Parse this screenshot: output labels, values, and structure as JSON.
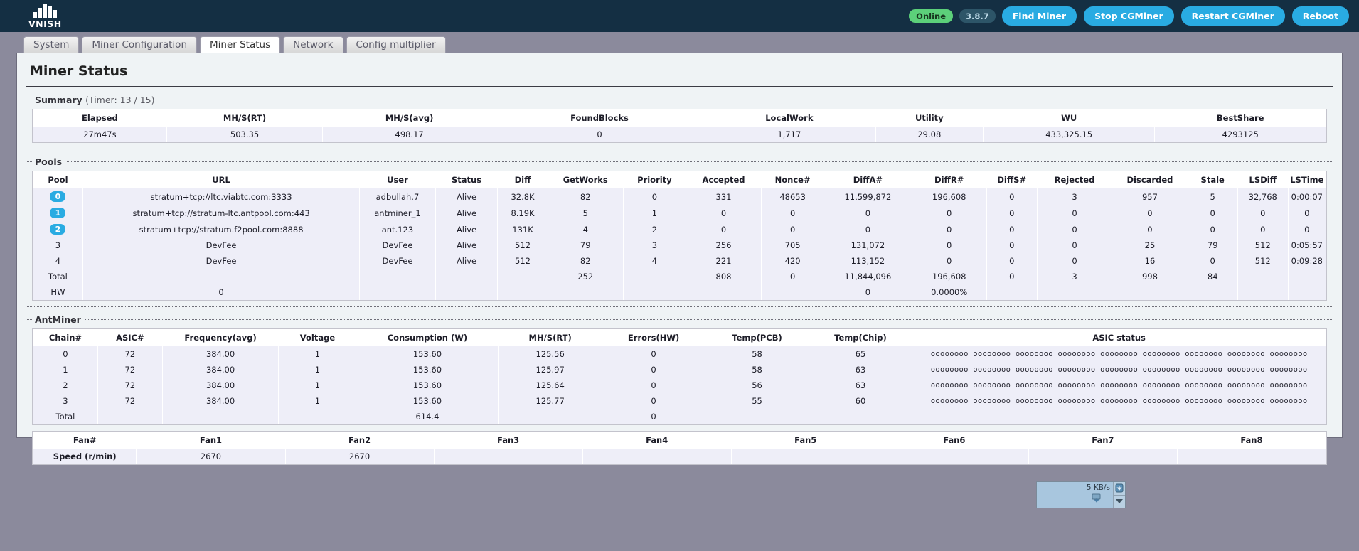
{
  "header": {
    "logo_text": "VNISH",
    "status_badge": "Online",
    "version_badge": "3.8.7",
    "buttons": [
      {
        "name": "find-miner",
        "label": "Find Miner"
      },
      {
        "name": "stop-cgminer",
        "label": "Stop CGMiner"
      },
      {
        "name": "restart-cgminer",
        "label": "Restart CGMiner"
      },
      {
        "name": "reboot",
        "label": "Reboot"
      }
    ],
    "accent_color": "#29abe2",
    "online_color": "#5cd07a",
    "bar_color": "#142f43"
  },
  "tabs": [
    {
      "label": "System",
      "active": false
    },
    {
      "label": "Miner Configuration",
      "active": false
    },
    {
      "label": "Miner Status",
      "active": true
    },
    {
      "label": "Network",
      "active": false
    },
    {
      "label": "Config multiplier",
      "active": false
    }
  ],
  "page": {
    "title": "Miner Status"
  },
  "summary": {
    "legend": "Summary",
    "timer": "(Timer: 13 / 15)",
    "columns": [
      "Elapsed",
      "MH/S(RT)",
      "MH/S(avg)",
      "FoundBlocks",
      "LocalWork",
      "Utility",
      "WU",
      "BestShare"
    ],
    "row": [
      "27m47s",
      "503.35",
      "498.17",
      "0",
      "1,717",
      "29.08",
      "433,325.15",
      "4293125"
    ]
  },
  "pools": {
    "legend": "Pools",
    "columns": [
      "Pool",
      "URL",
      "User",
      "Status",
      "Diff",
      "GetWorks",
      "Priority",
      "Accepted",
      "Nonce#",
      "DiffA#",
      "DiffR#",
      "DiffS#",
      "Rejected",
      "Discarded",
      "Stale",
      "LSDiff",
      "LSTime"
    ],
    "rows": [
      {
        "badge": true,
        "cells": [
          "0",
          "stratum+tcp://ltc.viabtc.com:3333",
          "adbullah.7",
          "Alive",
          "32.8K",
          "82",
          "0",
          "331",
          "48653",
          "11,599,872",
          "196,608",
          "0",
          "3",
          "957",
          "5",
          "32,768",
          "0:00:07"
        ]
      },
      {
        "badge": true,
        "cells": [
          "1",
          "stratum+tcp://stratum-ltc.antpool.com:443",
          "antminer_1",
          "Alive",
          "8.19K",
          "5",
          "1",
          "0",
          "0",
          "0",
          "0",
          "0",
          "0",
          "0",
          "0",
          "0",
          "0"
        ]
      },
      {
        "badge": true,
        "cells": [
          "2",
          "stratum+tcp://stratum.f2pool.com:8888",
          "ant.123",
          "Alive",
          "131K",
          "4",
          "2",
          "0",
          "0",
          "0",
          "0",
          "0",
          "0",
          "0",
          "0",
          "0",
          "0"
        ]
      },
      {
        "badge": false,
        "cells": [
          "3",
          "DevFee",
          "DevFee",
          "Alive",
          "512",
          "79",
          "3",
          "256",
          "705",
          "131,072",
          "0",
          "0",
          "0",
          "25",
          "79",
          "512",
          "0:05:57"
        ]
      },
      {
        "badge": false,
        "cells": [
          "4",
          "DevFee",
          "DevFee",
          "Alive",
          "512",
          "82",
          "4",
          "221",
          "420",
          "113,152",
          "0",
          "0",
          "0",
          "16",
          "0",
          "512",
          "0:09:28"
        ]
      },
      {
        "badge": false,
        "cells": [
          "Total",
          "",
          "",
          "",
          "",
          "252",
          "",
          "808",
          "0",
          "11,844,096",
          "196,608",
          "0",
          "3",
          "998",
          "84",
          "",
          ""
        ]
      },
      {
        "badge": false,
        "cells": [
          "HW",
          "0",
          "",
          "",
          "",
          "",
          "",
          "",
          "",
          "0",
          "0.0000%",
          "",
          "",
          "",
          "",
          "",
          ""
        ]
      }
    ]
  },
  "antminer": {
    "legend": "AntMiner",
    "columns": [
      "Chain#",
      "ASIC#",
      "Frequency(avg)",
      "Voltage",
      "Consumption (W)",
      "MH/S(RT)",
      "Errors(HW)",
      "Temp(PCB)",
      "Temp(Chip)",
      "ASIC status"
    ],
    "asic_status": "oooooooo oooooooo oooooooo oooooooo oooooooo oooooooo oooooooo oooooooo oooooooo",
    "rows": [
      {
        "cells": [
          "0",
          "72",
          "384.00",
          "1",
          "153.60",
          "125.56",
          "0",
          "58",
          "65"
        ],
        "asic": true
      },
      {
        "cells": [
          "1",
          "72",
          "384.00",
          "1",
          "153.60",
          "125.97",
          "0",
          "58",
          "63"
        ],
        "asic": true
      },
      {
        "cells": [
          "2",
          "72",
          "384.00",
          "1",
          "153.60",
          "125.64",
          "0",
          "56",
          "63"
        ],
        "asic": true
      },
      {
        "cells": [
          "3",
          "72",
          "384.00",
          "1",
          "153.60",
          "125.77",
          "0",
          "55",
          "60"
        ],
        "asic": true
      },
      {
        "cells": [
          "Total",
          "",
          "",
          "",
          "614.4",
          "",
          "0",
          "",
          ""
        ],
        "asic": false
      }
    ]
  },
  "fans": {
    "columns": [
      "Fan#",
      "Fan1",
      "Fan2",
      "Fan3",
      "Fan4",
      "Fan5",
      "Fan6",
      "Fan7",
      "Fan8"
    ],
    "row": [
      "Speed (r/min)",
      "2670",
      "2670",
      "",
      "",
      "",
      "",
      "",
      ""
    ]
  },
  "download_widget": {
    "speed": "5 KB/s",
    "download_icon": "download-arrow-icon",
    "expand_icon": "chevron-down-icon"
  }
}
